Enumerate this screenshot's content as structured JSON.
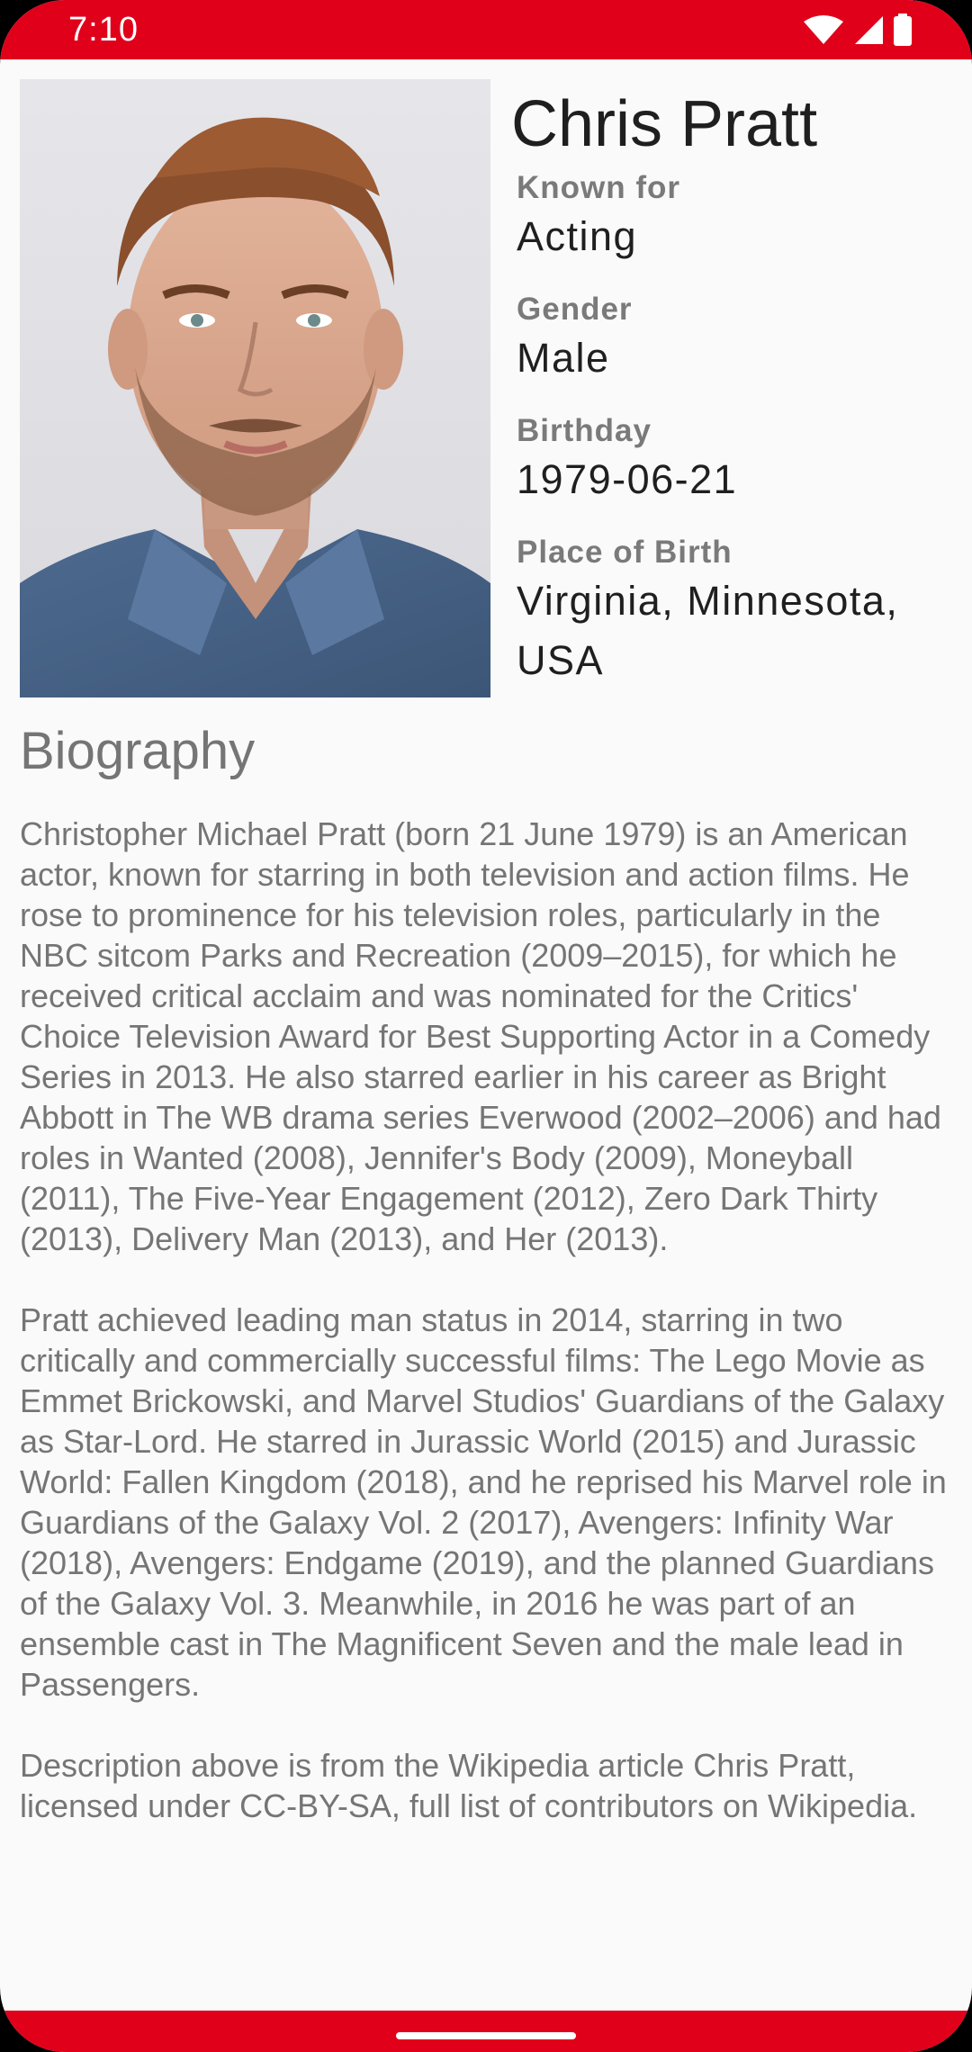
{
  "status_bar": {
    "time": "7:10",
    "icons": [
      "wifi-icon",
      "cellular-signal-icon",
      "battery-icon"
    ],
    "color": "#e0001a"
  },
  "person": {
    "name": "Chris Pratt",
    "photo_alt": "Chris Pratt",
    "fields": [
      {
        "label": "Known for",
        "value": "Acting"
      },
      {
        "label": "Gender",
        "value": "Male"
      },
      {
        "label": "Birthday",
        "value": "1979-06-21"
      },
      {
        "label": "Place of Birth",
        "value": "Virginia, Minnesota, USA"
      }
    ]
  },
  "biography": {
    "heading": "Biography",
    "text": "Christopher Michael Pratt (born 21 June 1979) is an American actor, known for starring in both television and action films. He rose to prominence for his television roles, particularly in the NBC sitcom Parks and Recreation (2009–2015), for which he received critical acclaim and was nominated for the Critics' Choice Television Award for Best Supporting Actor in a Comedy Series in 2013. He also starred earlier in his career as Bright Abbott in The WB drama series Everwood (2002–2006) and had roles in Wanted (2008), Jennifer's Body (2009), Moneyball (2011), The Five-Year Engagement (2012), Zero Dark Thirty (2013), Delivery Man (2013), and Her (2013).\n\nPratt achieved leading man status in 2014, starring in two critically and commercially successful films: The Lego Movie as Emmet Brickowski, and Marvel Studios' Guardians of the Galaxy as Star-Lord. He starred in Jurassic World (2015) and Jurassic World: Fallen Kingdom (2018), and he reprised his Marvel role in Guardians of the Galaxy Vol. 2 (2017), Avengers: Infinity War (2018), Avengers: Endgame (2019), and the planned Guardians of the Galaxy Vol. 3. Meanwhile, in 2016 he was part of an ensemble cast in The Magnificent Seven and the male lead in Passengers.\n\nDescription above is from the Wikipedia article Chris Pratt, licensed under CC-BY-SA, full list of contributors on Wikipedia."
  },
  "colors": {
    "accent": "#e0001a",
    "background": "#fafafa",
    "text_primary": "#1f1f1f",
    "text_secondary": "#757575"
  }
}
